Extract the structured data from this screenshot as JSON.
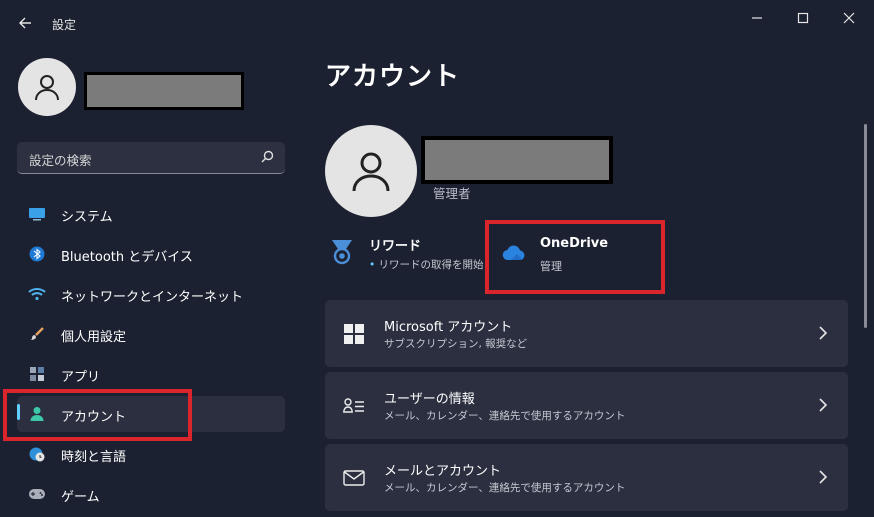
{
  "window": {
    "title": "設定",
    "back_icon": "arrow-left-icon",
    "minimize_icon": "minimize-icon",
    "maximize_icon": "maximize-icon",
    "close_icon": "close-icon"
  },
  "sidebar": {
    "avatar_icon": "person-icon",
    "search": {
      "placeholder": "設定の検索",
      "icon": "search-icon"
    },
    "items": [
      {
        "label": "システム",
        "icon": "monitor-icon",
        "selected": false
      },
      {
        "label": "Bluetooth とデバイス",
        "icon": "bluetooth-icon",
        "selected": false
      },
      {
        "label": "ネットワークとインターネット",
        "icon": "wifi-icon",
        "selected": false
      },
      {
        "label": "個人用設定",
        "icon": "paintbrush-icon",
        "selected": false
      },
      {
        "label": "アプリ",
        "icon": "apps-icon",
        "selected": false
      },
      {
        "label": "アカウント",
        "icon": "account-icon",
        "selected": true
      },
      {
        "label": "時刻と言語",
        "icon": "clock-globe-icon",
        "selected": false
      },
      {
        "label": "ゲーム",
        "icon": "gamepad-icon",
        "selected": false
      }
    ]
  },
  "main": {
    "page_title": "アカウント",
    "profile": {
      "role": "管理者",
      "avatar_icon": "person-icon"
    },
    "rewards": {
      "title": "リワード",
      "subtitle": "リワードの取得を開始",
      "bullet": "•",
      "icon": "medal-icon"
    },
    "onedrive": {
      "title": "OneDrive",
      "subtitle": "管理",
      "icon": "cloud-icon"
    },
    "cards": [
      {
        "title": "Microsoft アカウント",
        "subtitle": "サブスクリプション, 報奨など",
        "icon": "windows-logo-icon"
      },
      {
        "title": "ユーザーの情報",
        "subtitle": "メール、カレンダー、連絡先で使用するアカウント",
        "icon": "user-info-icon"
      },
      {
        "title": "メールとアカウント",
        "subtitle": "メール、カレンダー、連絡先で使用するアカウント",
        "icon": "mail-icon"
      }
    ]
  },
  "colors": {
    "background": "#1c2131",
    "card": "#2b2f3f",
    "accent": "#60cdff",
    "highlight_red": "#d9252b"
  }
}
